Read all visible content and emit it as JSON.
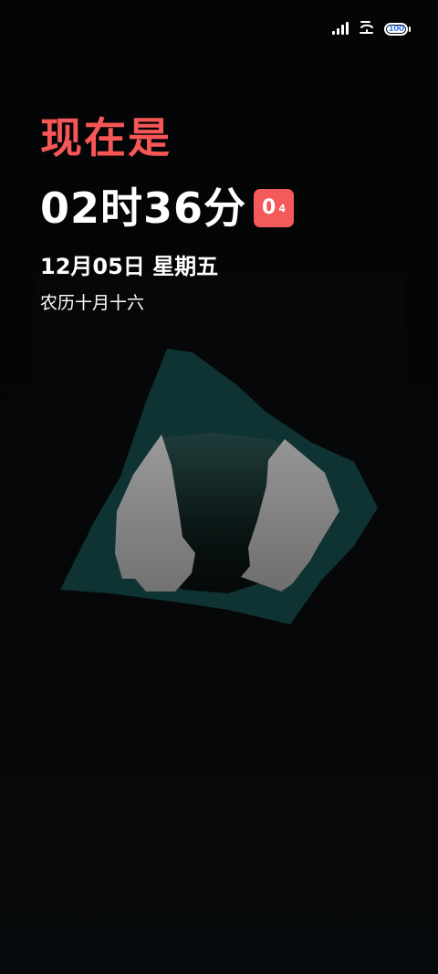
{
  "status_bar": {
    "battery_level": "100",
    "battery_fraction": 1.0,
    "icons": [
      "signal-icon",
      "wifi-icon",
      "battery-icon"
    ]
  },
  "clock": {
    "greeting": "现在是",
    "time": "02时36分",
    "seconds_main": "0",
    "seconds_small": "4",
    "date": "12月05日 星期五",
    "lunar_date": "农历十月十六"
  },
  "colors": {
    "accent_red": "#f65656",
    "background": "#040506",
    "artwork_teal": "#0f3332",
    "rock_gray": "#8a8a8a",
    "battery_text": "#3c7df0"
  },
  "artwork": {
    "icon": "abstract-mountain-art"
  }
}
